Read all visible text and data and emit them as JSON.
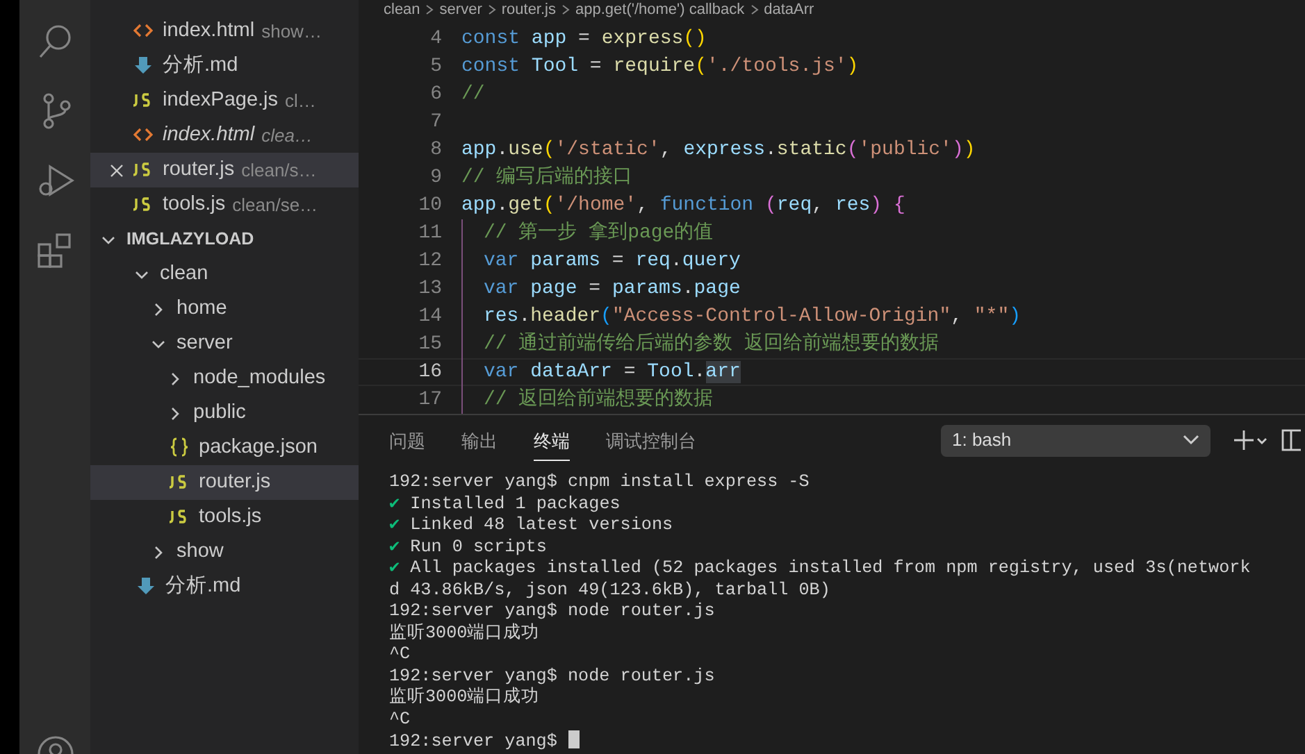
{
  "open_editors": [
    {
      "kind": "html",
      "name": "index.html",
      "desc": "show…",
      "italic": false,
      "selected": false
    },
    {
      "kind": "md",
      "name": "分析.md",
      "italic": false,
      "selected": false
    },
    {
      "kind": "js",
      "name": "indexPage.js",
      "desc": "cl…",
      "italic": false,
      "selected": false
    },
    {
      "kind": "html",
      "name": "index.html",
      "desc": "clea…",
      "italic": true,
      "selected": false
    },
    {
      "kind": "js",
      "name": "router.js",
      "desc": "clean/s…",
      "italic": false,
      "selected": true
    },
    {
      "kind": "js",
      "name": "tools.js",
      "desc": "clean/se…",
      "italic": false,
      "selected": false
    }
  ],
  "explorer": {
    "title": "IMGLAZYLOAD",
    "expanded": true,
    "children": [
      {
        "kind": "folder",
        "name": "clean",
        "expanded": true,
        "children": [
          {
            "kind": "folder",
            "name": "home",
            "expanded": false
          },
          {
            "kind": "folder",
            "name": "server",
            "expanded": true,
            "children": [
              {
                "kind": "folder",
                "name": "node_modules",
                "expanded": false
              },
              {
                "kind": "folder",
                "name": "public",
                "expanded": false
              },
              {
                "kind": "json",
                "name": "package.json",
                "selected": false
              },
              {
                "kind": "js",
                "name": "router.js",
                "selected": true
              },
              {
                "kind": "js",
                "name": "tools.js",
                "selected": false
              }
            ]
          },
          {
            "kind": "folder",
            "name": "show",
            "expanded": false
          }
        ]
      },
      {
        "kind": "md",
        "name": "分析.md",
        "selected": false
      }
    ]
  },
  "breadcrumb": [
    "clean",
    "server",
    "router.js",
    "app.get('/home') callback",
    "dataArr"
  ],
  "editor": {
    "lines": [
      {
        "number": "4",
        "current": false,
        "tokens": [
          {
            "kind": "kw",
            "text": "const"
          },
          {
            "kind": "var",
            "text": " app"
          },
          {
            "kind": "plain",
            "text": " = "
          },
          {
            "kind": "fn",
            "text": "express"
          },
          {
            "kind": "p1",
            "text": "()"
          }
        ]
      },
      {
        "number": "5",
        "current": false,
        "tokens": [
          {
            "kind": "kw",
            "text": "const"
          },
          {
            "kind": "var",
            "text": " Tool"
          },
          {
            "kind": "plain",
            "text": " = "
          },
          {
            "kind": "fn",
            "text": "require"
          },
          {
            "kind": "p1",
            "text": "("
          },
          {
            "kind": "str",
            "text": "'./tools.js'"
          },
          {
            "kind": "p1",
            "text": ")"
          }
        ]
      },
      {
        "number": "6",
        "current": false,
        "tokens": [
          {
            "kind": "cm",
            "text": "//"
          }
        ]
      },
      {
        "number": "7",
        "current": false
      },
      {
        "number": "8",
        "current": false,
        "tokens": [
          {
            "kind": "var",
            "text": "app"
          },
          {
            "kind": "plain",
            "text": "."
          },
          {
            "kind": "fn",
            "text": "use"
          },
          {
            "kind": "p1",
            "text": "("
          },
          {
            "kind": "str",
            "text": "'/static'"
          },
          {
            "kind": "plain",
            "text": ", "
          },
          {
            "kind": "var",
            "text": "express"
          },
          {
            "kind": "plain",
            "text": "."
          },
          {
            "kind": "fn",
            "text": "static"
          },
          {
            "kind": "p2",
            "text": "("
          },
          {
            "kind": "str",
            "text": "'public'"
          },
          {
            "kind": "p2",
            "text": ")"
          },
          {
            "kind": "p1",
            "text": ")"
          }
        ]
      },
      {
        "number": "9",
        "current": false,
        "tokens": [
          {
            "kind": "cm",
            "text": "// 编写后端的接口"
          }
        ]
      },
      {
        "number": "10",
        "current": false,
        "tokens": [
          {
            "kind": "var",
            "text": "app"
          },
          {
            "kind": "plain",
            "text": "."
          },
          {
            "kind": "fn",
            "text": "get"
          },
          {
            "kind": "p1",
            "text": "("
          },
          {
            "kind": "str",
            "text": "'/home'"
          },
          {
            "kind": "plain",
            "text": ", "
          },
          {
            "kind": "kw",
            "text": "function"
          },
          {
            "kind": "p2",
            "text": " ("
          },
          {
            "kind": "var",
            "text": "req"
          },
          {
            "kind": "plain",
            "text": ", "
          },
          {
            "kind": "var",
            "text": "res"
          },
          {
            "kind": "p2",
            "text": ")"
          },
          {
            "kind": "p2",
            "text": " {"
          }
        ],
        "children": [
          {
            "number": "11",
            "current": false,
            "tokens": [
              {
                "kind": "cm",
                "text": "// 第一步 拿到page的值"
              }
            ]
          },
          {
            "number": "12",
            "current": false,
            "tokens": [
              {
                "kind": "kw",
                "text": "var"
              },
              {
                "kind": "var",
                "text": " params"
              },
              {
                "kind": "plain",
                "text": " = "
              },
              {
                "kind": "var",
                "text": "req"
              },
              {
                "kind": "plain",
                "text": "."
              },
              {
                "kind": "var",
                "text": "query"
              }
            ]
          },
          {
            "number": "13",
            "current": false,
            "tokens": [
              {
                "kind": "kw",
                "text": "var"
              },
              {
                "kind": "var",
                "text": " page"
              },
              {
                "kind": "plain",
                "text": " = "
              },
              {
                "kind": "var",
                "text": "params"
              },
              {
                "kind": "plain",
                "text": "."
              },
              {
                "kind": "var",
                "text": "page"
              }
            ]
          },
          {
            "number": "14",
            "current": false,
            "tokens": [
              {
                "kind": "var",
                "text": "res"
              },
              {
                "kind": "plain",
                "text": "."
              },
              {
                "kind": "fn",
                "text": "header"
              },
              {
                "kind": "p3",
                "text": "("
              },
              {
                "kind": "str",
                "text": "\"Access-Control-Allow-Origin\""
              },
              {
                "kind": "plain",
                "text": ", "
              },
              {
                "kind": "str",
                "text": "\"*\""
              },
              {
                "kind": "p3",
                "text": ")"
              }
            ]
          },
          {
            "number": "15",
            "current": false,
            "tokens": [
              {
                "kind": "cm",
                "text": "// 通过前端传给后端的参数 返回给前端想要的数据"
              }
            ]
          },
          {
            "number": "16",
            "current": true,
            "tokens": [
              {
                "kind": "kw",
                "text": "var"
              },
              {
                "kind": "var",
                "text": " dataArr"
              },
              {
                "kind": "plain",
                "text": " = "
              },
              {
                "kind": "var",
                "text": "Tool"
              },
              {
                "kind": "plain",
                "text": "."
              },
              {
                "kind": "hl",
                "text": "arr"
              }
            ]
          },
          {
            "number": "17",
            "current": false,
            "tokens": [
              {
                "kind": "cm",
                "text": "// 返回给前端想要的数据"
              }
            ]
          }
        ]
      }
    ]
  },
  "panel": {
    "tabs": [
      {
        "label": "问题",
        "selected": false
      },
      {
        "label": "输出",
        "selected": false
      },
      {
        "label": "终端",
        "selected": true
      },
      {
        "label": "调试控制台",
        "selected": false
      }
    ],
    "terminal_select": "1: bash",
    "terminal": [
      {
        "text": "192:server yang$ cnpm install express -S"
      },
      {
        "mark": "✔",
        "text": "Installed 1 packages"
      },
      {
        "mark": "✔",
        "text": "Linked 48 latest versions"
      },
      {
        "mark": "✔",
        "text": "Run 0 scripts"
      },
      {
        "mark": "✔",
        "text": "All packages installed (52 packages installed from npm registry, used 3s(network"
      },
      {
        "text": "d 43.86kB/s, json 49(123.6kB), tarball 0B)"
      },
      {
        "text": "192:server yang$ node router.js"
      },
      {
        "text": "监听3000端口成功"
      },
      {
        "text": "^C"
      },
      {
        "text": "192:server yang$ node router.js"
      },
      {
        "text": "监听3000端口成功"
      },
      {
        "text": "^C"
      }
    ],
    "prompt": "192:server yang$"
  }
}
